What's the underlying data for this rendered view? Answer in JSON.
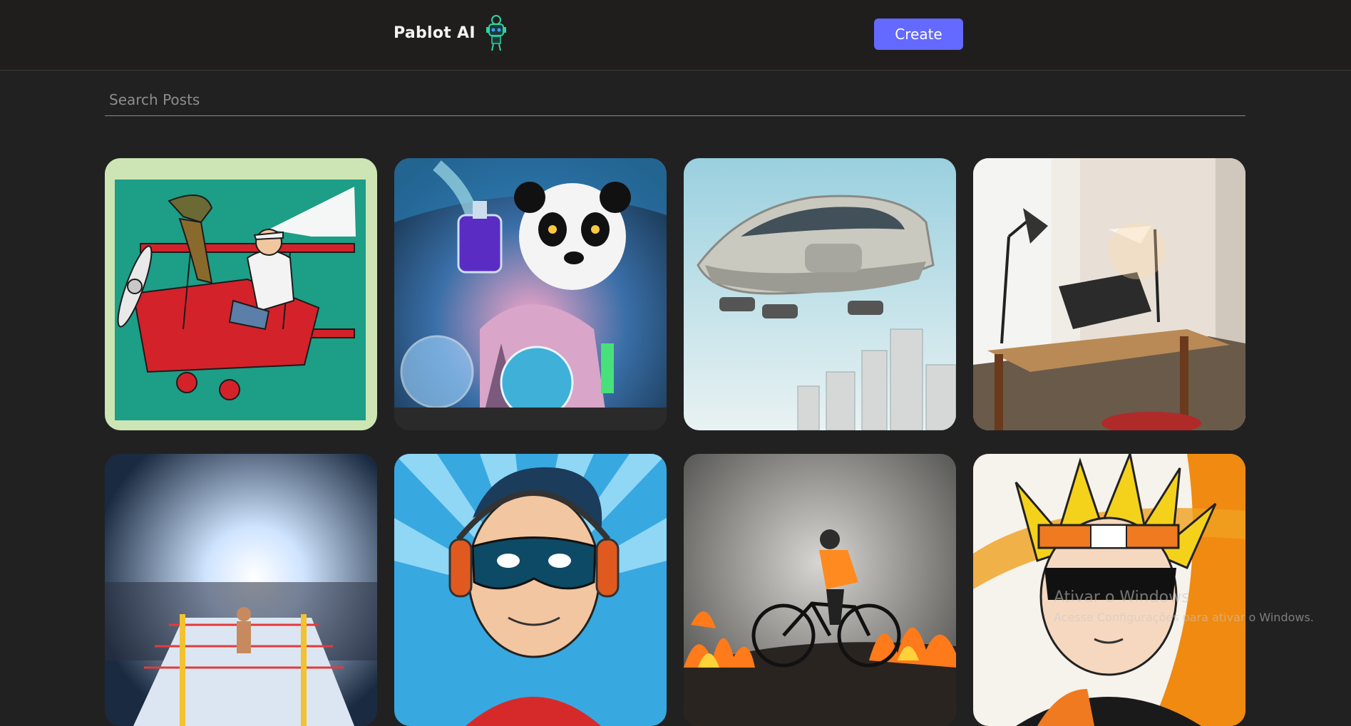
{
  "header": {
    "brand": "Pablot AI",
    "create_label": "Create",
    "accent": "#6469ff"
  },
  "search": {
    "placeholder": "Search Posts",
    "value": ""
  },
  "posts": [
    {
      "subject": "dinosaur flying red biplane with pilot"
    },
    {
      "subject": "panda scientist with potions"
    },
    {
      "subject": "flying car over city"
    },
    {
      "subject": "desk with lamps"
    },
    {
      "subject": "stadium boxing ring with bright lights"
    },
    {
      "subject": "cartoon masked hero with headphones"
    },
    {
      "subject": "cyclist riding through fire"
    },
    {
      "subject": "anime character with headband and visor"
    }
  ],
  "watermark": {
    "title": "Ativar o Windows",
    "subtitle": "Acesse Configurações para ativar o Windows."
  }
}
